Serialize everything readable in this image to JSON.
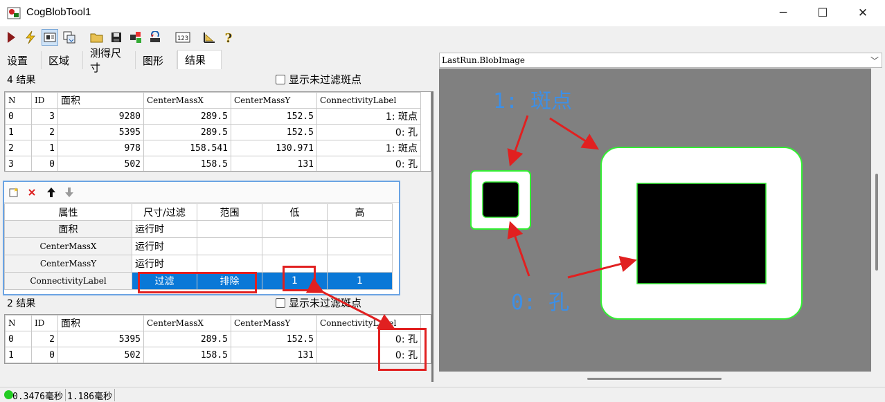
{
  "window": {
    "title": "CogBlobTool1",
    "minimize": "─",
    "maximize": "☐",
    "close": "✕"
  },
  "tabs": [
    "设置",
    "区域",
    "测得尺寸",
    "图形",
    "结果"
  ],
  "results_top": {
    "title": "4 结果",
    "checkbox_label": "显示未过滤斑点",
    "columns": [
      "N",
      "ID",
      "面积",
      "CenterMassX",
      "CenterMassY",
      "ConnectivityLabel"
    ],
    "rows": [
      [
        "0",
        "3",
        "9280",
        "289.5",
        "152.5",
        "1: 斑点"
      ],
      [
        "1",
        "2",
        "5395",
        "289.5",
        "152.5",
        "0: 孔"
      ],
      [
        "2",
        "1",
        "978",
        "158.541",
        "130.971",
        "1: 斑点"
      ],
      [
        "3",
        "0",
        "502",
        "158.5",
        "131",
        "0: 孔"
      ]
    ]
  },
  "filter": {
    "columns": [
      "属性",
      "尺寸/过滤",
      "范围",
      "低",
      "高"
    ],
    "rows": [
      [
        "面积",
        "运行时",
        "",
        "",
        ""
      ],
      [
        "CenterMassX",
        "运行时",
        "",
        "",
        ""
      ],
      [
        "CenterMassY",
        "运行时",
        "",
        "",
        ""
      ],
      [
        "ConnectivityLabel",
        "过滤",
        "排除",
        "1",
        "1"
      ]
    ]
  },
  "results_bottom": {
    "title": "2 结果",
    "checkbox_label": "显示未过滤斑点",
    "columns": [
      "N",
      "ID",
      "面积",
      "CenterMassX",
      "CenterMassY",
      "ConnectivityLabel"
    ],
    "rows": [
      [
        "0",
        "2",
        "5395",
        "289.5",
        "152.5",
        "0: 孔"
      ],
      [
        "1",
        "0",
        "502",
        "158.5",
        "131",
        "0: 孔"
      ]
    ]
  },
  "image_view": {
    "selector_value": "LastRun.BlobImage",
    "label_blob": "1: 斑点",
    "label_hole": "0: 孔"
  },
  "status": {
    "time1": "0.3476毫秒",
    "time2": "1.186毫秒",
    "indicator_color": "#22cc22"
  },
  "colors": {
    "accent": "#0a78d7",
    "annotation": "#e12020",
    "blob_outline": "#33ee33"
  }
}
